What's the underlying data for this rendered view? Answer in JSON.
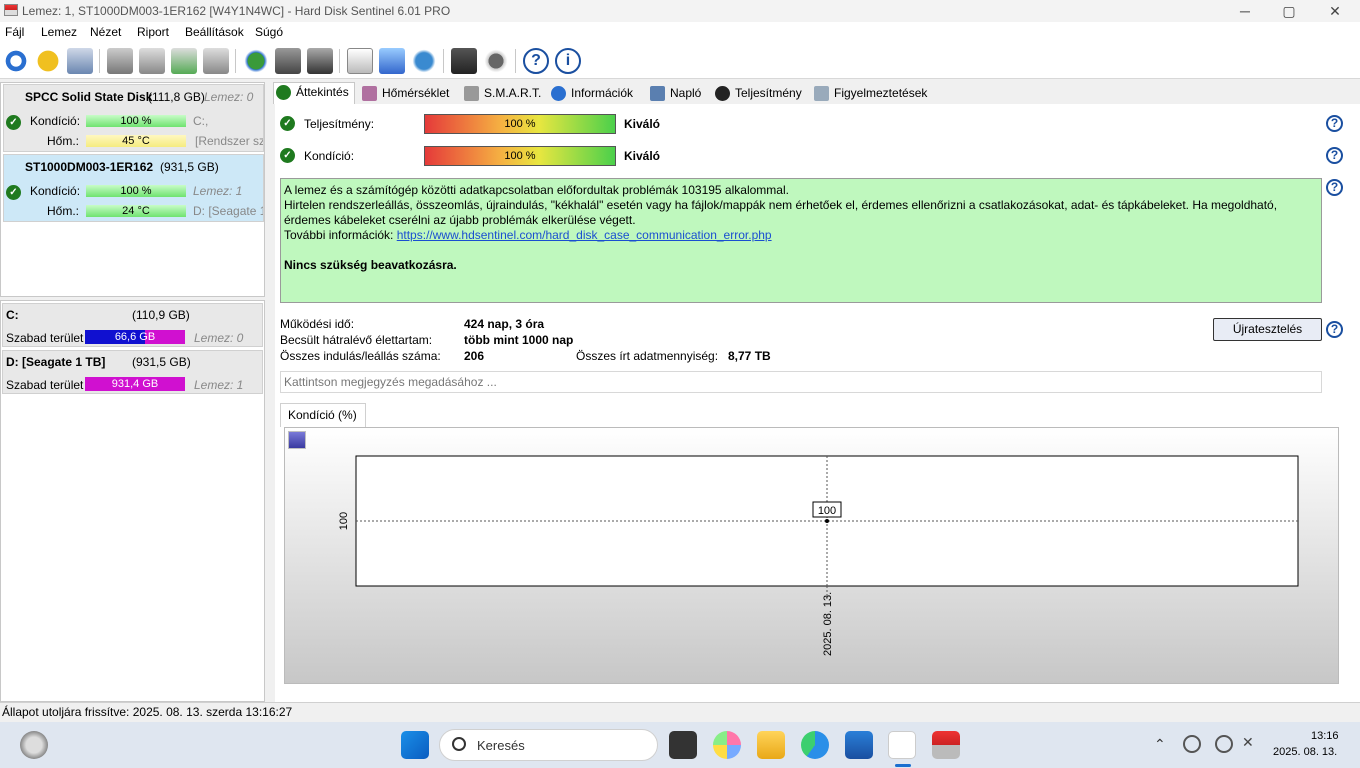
{
  "window": {
    "title": "Lemez: 1, ST1000DM003-1ER162 [W4Y1N4WC]  -  Hard Disk Sentinel 6.01 PRO",
    "minimize": "─",
    "maximize": "▢",
    "close": "✕"
  },
  "menu": [
    {
      "label": "Fájl"
    },
    {
      "label": "Lemez"
    },
    {
      "label": "Nézet"
    },
    {
      "label": "Riport"
    },
    {
      "label": "Beállítások"
    },
    {
      "label": "Súgó"
    }
  ],
  "disks": [
    {
      "name": "SPCC Solid State Disk",
      "size": "(111,8 GB)",
      "index": "Lemez: 0",
      "cond_label": "Kondíció:",
      "cond": "100 %",
      "cond_side": "C:,",
      "temp_label": "Hőm.:",
      "temp": "45 °C",
      "temp_side": "[Rendszer szá"
    },
    {
      "name": "ST1000DM003-1ER162",
      "size": "(931,5 GB)",
      "index": "",
      "cond_label": "Kondíció:",
      "cond": "100 %",
      "cond_side": "Lemez: 1",
      "temp_label": "Hőm.:",
      "temp": "24 °C",
      "temp_side": "D: [Seagate 1"
    }
  ],
  "volumes": [
    {
      "name": "C:",
      "size": "(110,9 GB)",
      "free_label": "Szabad terület",
      "free": "66,6 GB",
      "free_pct": 0.6,
      "disk": "Lemez: 0",
      "color": "#1010d0"
    },
    {
      "name": "D: [Seagate 1 TB]",
      "size": "(931,5 GB)",
      "free_label": "Szabad terület",
      "free": "931,4 GB",
      "free_pct": 1.0,
      "disk": "Lemez: 1",
      "color": "#d010d0"
    }
  ],
  "tabs": [
    "Áttekintés",
    "Hőmérséklet",
    "S.M.A.R.T.",
    "Információk",
    "Napló",
    "Teljesítmény",
    "Figyelmeztetések"
  ],
  "overview": {
    "perf_label": "Teljesítmény:",
    "perf_value": "100 %",
    "perf_rating": "Kiváló",
    "cond_label": "Kondíció:",
    "cond_value": "100 %",
    "cond_rating": "Kiváló",
    "msg1": "A lemez és a számítógép közötti adatkapcsolatban előfordultak problémák 103195 alkalommal.",
    "msg2": "Hirtelen rendszerleállás, összeomlás, újraindulás, \"kékhalál\" esetén vagy ha fájlok/mappák nem érhetőek el, érdemes ellenőrizni a csatlakozásokat, adat- és tápkábeleket. Ha megoldható,",
    "msg3": "érdemes kábeleket cserélni az újabb problémák elkerülése végett.",
    "msg4_label": "További információk: ",
    "msg4_link": "https://www.hdsentinel.com/hard_disk_case_communication_error.php",
    "msg5": "Nincs szükség beavatkozásra.",
    "uptime_label": "Működési idő:",
    "uptime": "424 nap, 3 óra",
    "life_label": "Becsült hátralévő élettartam:",
    "life": "több mint 1000 nap",
    "starts_label": "Összes indulás/leállás száma:",
    "starts": "206",
    "written_label": "Összes írt adatmennyiség:",
    "written": "8,77 TB",
    "retest": "Újratesztelés",
    "notes_placeholder": "Kattintson megjegyzés megadásához ...",
    "chart_tab": "Kondíció  (%)"
  },
  "chart_data": {
    "type": "line",
    "x": [
      "2025. 08. 13."
    ],
    "values": [
      100
    ],
    "ytick": "100",
    "point_label": "100"
  },
  "status": "Állapot utoljára frissítve: 2025. 08. 13. szerda 13:16:27",
  "taskbar": {
    "search": "Keresés",
    "time": "13:16",
    "date": "2025. 08. 13."
  }
}
